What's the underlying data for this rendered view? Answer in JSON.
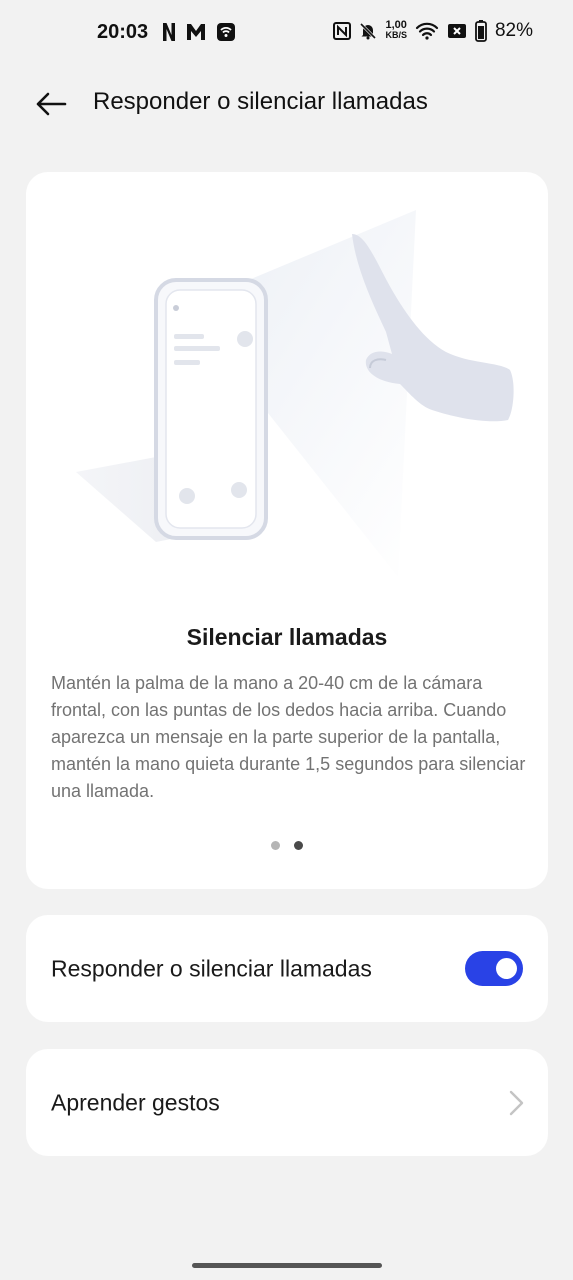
{
  "status": {
    "time": "20:03",
    "left_icons": [
      "netflix-icon",
      "m-app-icon",
      "wifi-hotspot-icon"
    ],
    "right_icons": [
      "nfc-icon",
      "bell-muted-icon",
      "wifi-icon",
      "no-sim-icon",
      "battery-icon"
    ],
    "net_speed_value": "1,00",
    "net_speed_unit": "KB/S",
    "battery_percent": "82%"
  },
  "header": {
    "title": "Responder o silenciar llamadas",
    "back_icon": "arrow-left-icon"
  },
  "tutorial": {
    "illustration": "phone-with-hand-gesture",
    "heading": "Silenciar llamadas",
    "description": "Mantén la palma de la mano a 20-40 cm de la cámara frontal, con las puntas de los dedos hacia arriba. Cuando aparezca un mensaje en la parte superior de la pantalla, mantén la mano quieta durante 1,5 segundos para silenciar una llamada.",
    "pages": 2,
    "active_page": 2
  },
  "toggle_row": {
    "label": "Responder o silenciar llamadas",
    "enabled": true,
    "accent": "#2942e6"
  },
  "learn_row": {
    "label": "Aprender gestos",
    "icon": "chevron-right-icon"
  }
}
